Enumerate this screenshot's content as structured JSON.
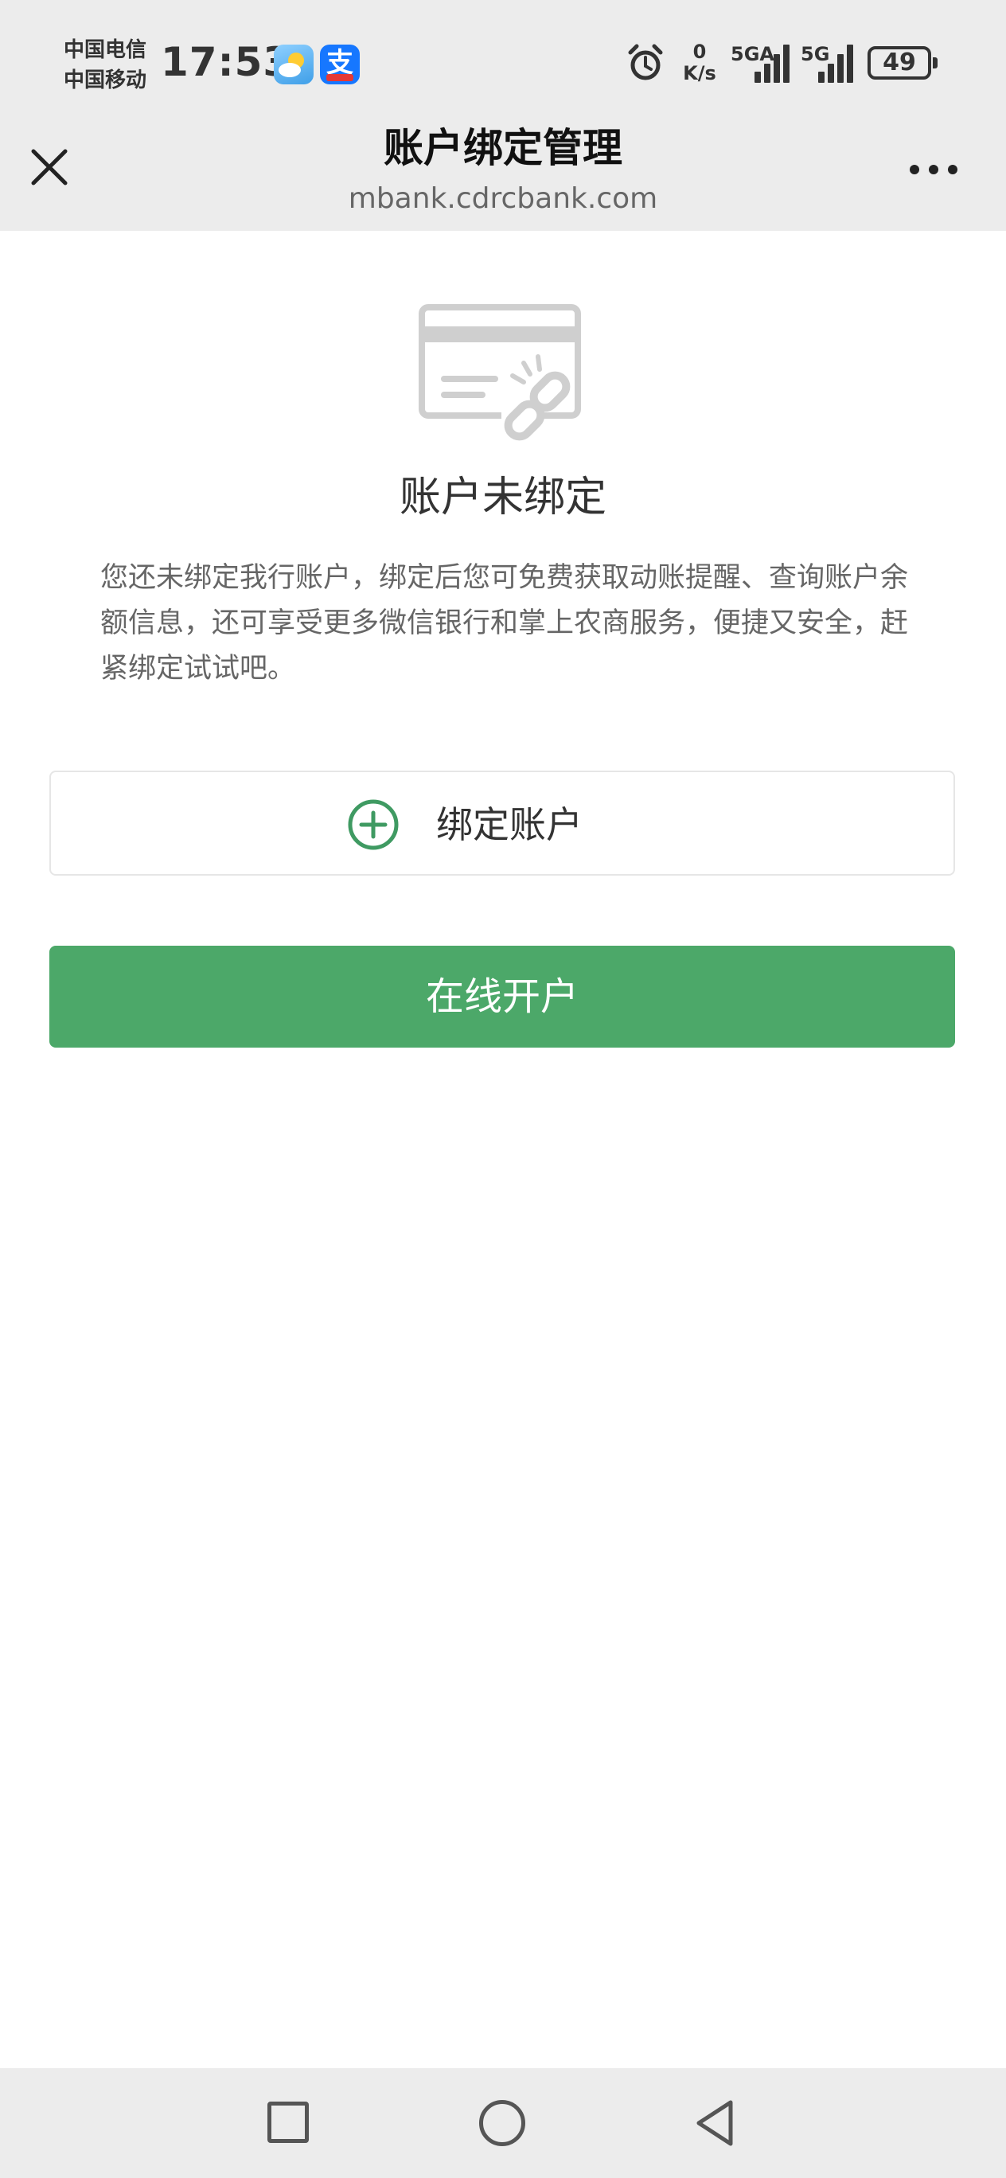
{
  "status_bar": {
    "carrier_1": "中国电信",
    "carrier_2": "中国移动",
    "time": "17:53",
    "net_speed_value": "0",
    "net_speed_unit": "K/s",
    "signal_1_label": "5GA",
    "signal_2_label": "5G",
    "battery": "49",
    "icons": [
      "weather-app-icon",
      "alipay-app-icon",
      "alarm-icon",
      "signal-icon",
      "battery-icon"
    ]
  },
  "header": {
    "title": "账户绑定管理",
    "domain": "mbank.cdrcbank.com",
    "close_icon": "close-icon",
    "more_icon": "more-icon"
  },
  "main": {
    "illustration_icon": "card-unlinked-icon",
    "status_title": "账户未绑定",
    "description": "您还未绑定我行账户，绑定后您可免费获取动账提醒、查询账户余额信息，还可享受更多微信银行和掌上农商服务，便捷又安全，赶紧绑定试试吧。",
    "bind_button_label": "绑定账户",
    "open_button_label": "在线开户"
  },
  "colors": {
    "accent_green": "#4ca869",
    "bar_background": "#ececec"
  },
  "nav_bar": {
    "icons": [
      "recent-apps-icon",
      "home-icon",
      "back-icon"
    ]
  }
}
